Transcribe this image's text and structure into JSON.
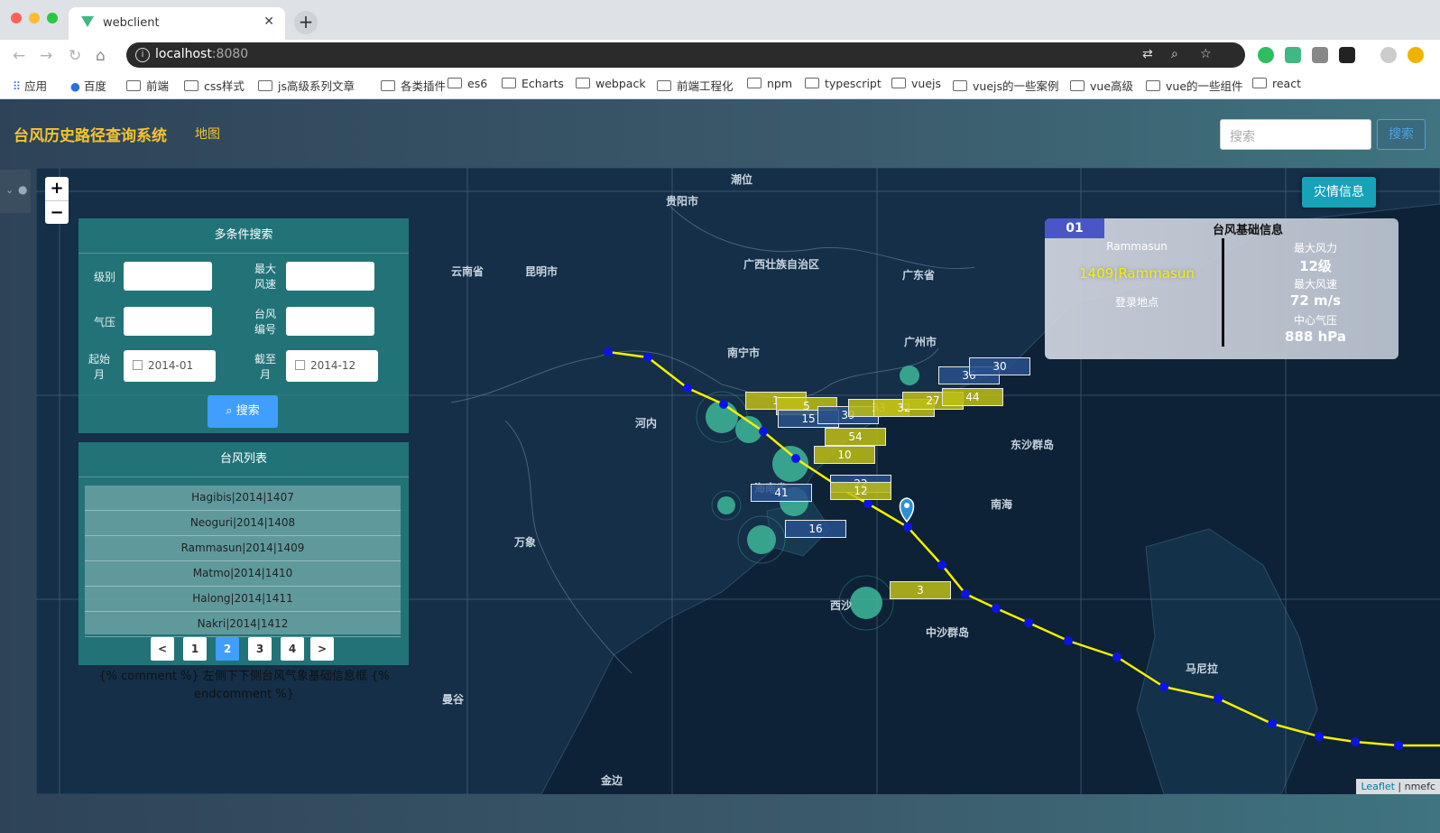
{
  "browser": {
    "tab_title": "webclient",
    "url_host": "localhost",
    "url_port": ":8080",
    "bookmarks": [
      "应用",
      "百度",
      "前端",
      "css样式",
      "js高级系列文章",
      "各类插件",
      "es6",
      "Echarts",
      "webpack",
      "前端工程化",
      "npm",
      "typescript",
      "vuejs",
      "vuejs的一些案例",
      "vue高级",
      "vue的一些组件",
      "react"
    ]
  },
  "app": {
    "title": "台风历史路径查询系统",
    "nav_map": "地图",
    "search_placeholder": "搜索",
    "search_button": "搜索"
  },
  "filter_panel": {
    "title": "多条件搜索",
    "level_label": "级别",
    "max_wind_label_1": "最大",
    "max_wind_label_2": "风速",
    "pressure_label": "气压",
    "typhoon_no_label_1": "台风",
    "typhoon_no_label_2": "编号",
    "start_label_1": "起始",
    "start_label_2": "月",
    "end_label_1": "截至",
    "end_label_2": "月",
    "start_value": "2014-01",
    "end_value": "2014-12",
    "search_button": "搜索"
  },
  "typhoon_list": {
    "title": "台风列表",
    "items": [
      "Hagibis|2014|1407",
      "Neoguri|2014|1408",
      "Rammasun|2014|1409",
      "Matmo|2014|1410",
      "Halong|2014|1411",
      "Nakri|2014|1412"
    ],
    "pages": [
      "1",
      "2",
      "3",
      "4"
    ],
    "active_page": "2",
    "prev": "<",
    "next": ">"
  },
  "comment_text": "{% comment %} 左侧下下侧台风气象基础信息框 {% endcomment %}",
  "disaster_button": "灾情信息",
  "info_panel": {
    "number": "01",
    "title": "台风基础信息",
    "name": "Rammasun",
    "id_name": "1409|Rammasun",
    "landing_label": "登录地点",
    "max_force_label": "最大风力",
    "max_force_value": "12级",
    "max_speed_label": "最大风速",
    "max_speed_value": "72 m/s",
    "center_pressure_label": "中心气压",
    "center_pressure_value": "888 hPa"
  },
  "map_labels": [
    "潮位",
    "贵阳市",
    "云南省",
    "昆明市",
    "广西壮族自治区",
    "广东省",
    "南宁市",
    "广州市",
    "河内",
    "东沙群岛",
    "南海",
    "万象",
    "中沙群岛",
    "马尼拉",
    "曼谷",
    "金边",
    "西沙",
    "海南省"
  ],
  "disaster_markers": [
    "1",
    "5",
    "15",
    "39",
    "33",
    "32",
    "36",
    "30",
    "27",
    "44",
    "54",
    "10",
    "22",
    "41",
    "12",
    "16",
    "3"
  ],
  "attribution": {
    "leaflet": "Leaflet",
    "sep": " | ",
    "source": "nmefc"
  },
  "colors": {
    "track": "#f5f000",
    "point": "#0a14e6",
    "accent": "#f4c430",
    "panel": "#268282"
  }
}
